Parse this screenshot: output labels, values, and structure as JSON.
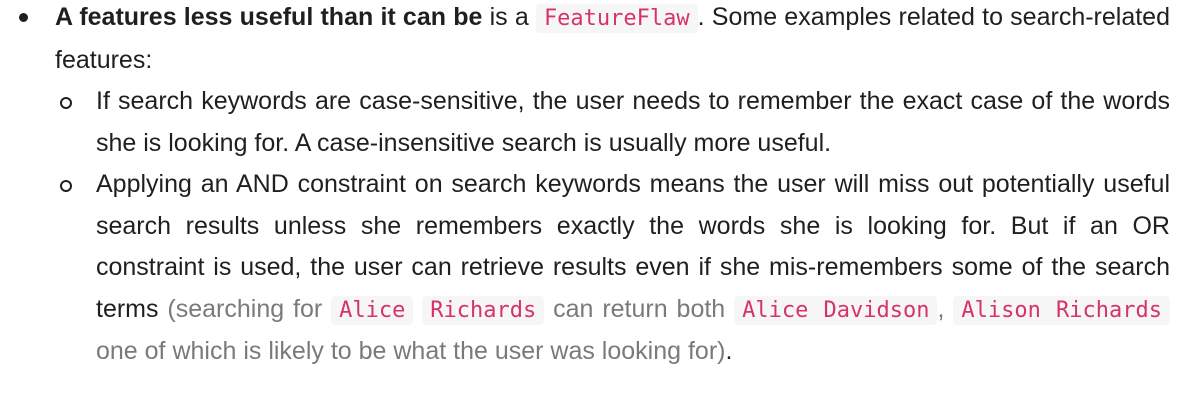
{
  "outer_item": {
    "bold_text": "A features less useful than it can be",
    "text_after_bold": " is a ",
    "code_feature_flaw": "FeatureFlaw",
    "text_after_code": ". Some examples related to search-related features:"
  },
  "sub_items": [
    {
      "text": "If search keywords are case-sensitive, the user needs to remember the exact case of the words she is looking for. A case-insensitive search is usually more useful."
    },
    {
      "text_main": "Applying an AND constraint on search keywords means the user will miss out potentially useful search results unless she remembers exactly the words she is looking for. But if an OR constraint is used, the user can retrieve results even if she mis-remembers some of the search terms ",
      "muted_open": "(searching for ",
      "code_alice": "Alice",
      "code_richards": "Richards",
      "muted_can_return": " can return both ",
      "code_alice_davidson": "Alice Davidson",
      "muted_comma": ", ",
      "code_alison_richards": "Alison Richards",
      "muted_close": " one of which is likely to be what the user was looking for)",
      "period": "."
    }
  ]
}
